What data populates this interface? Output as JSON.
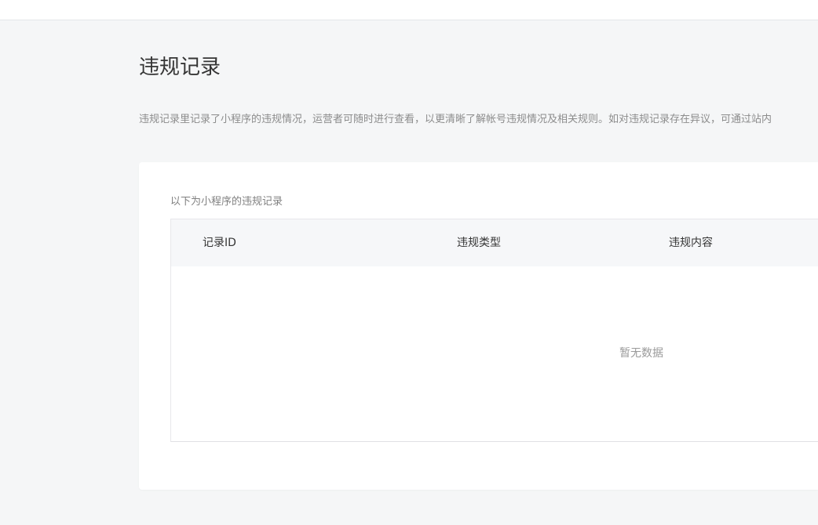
{
  "page": {
    "title": "违规记录",
    "description": "违规记录里记录了小程序的违规情况，运营者可随时进行查看，以更清晰了解帐号违规情况及相关规则。如对违规记录存在异议，可通过站内"
  },
  "records": {
    "caption": "以下为小程序的违规记录",
    "columns": [
      "记录ID",
      "违规类型",
      "违规内容"
    ],
    "rows": [],
    "empty_text": "暂无数据"
  },
  "colors": {
    "background": "#f5f6f7",
    "card": "#ffffff",
    "header_row": "#f6f7f9",
    "title_text": "#353535",
    "muted_text": "#8c8c8c"
  }
}
